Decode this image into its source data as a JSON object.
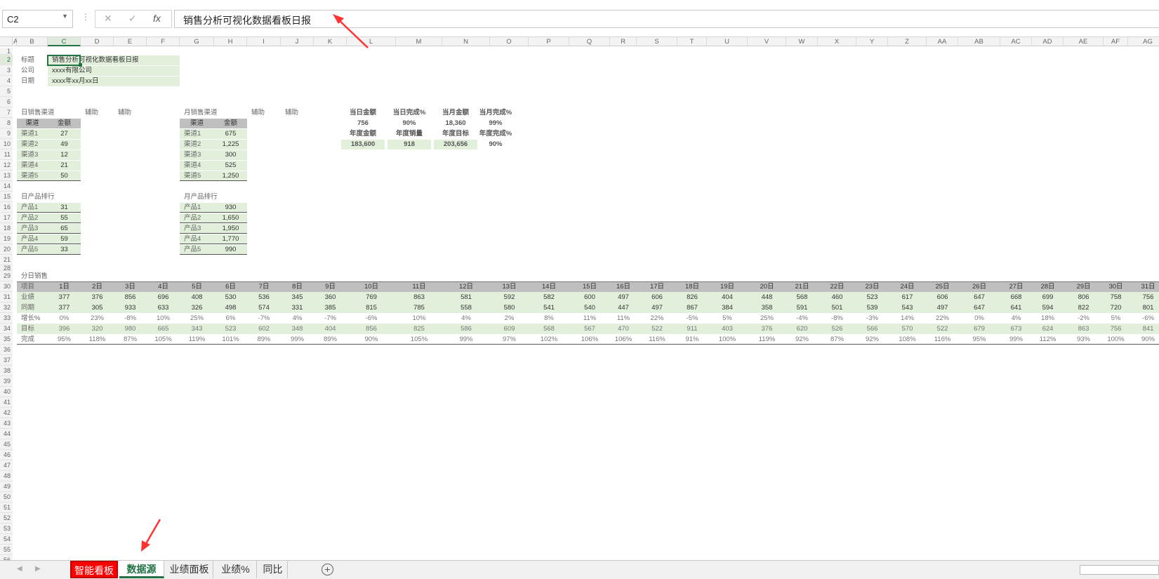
{
  "app": {
    "name_box": "C2",
    "formula": "销售分析可视化数据看板日报"
  },
  "columns": [
    "A",
    "B",
    "C",
    "D",
    "E",
    "F",
    "G",
    "H",
    "I",
    "J",
    "K",
    "L",
    "M",
    "N",
    "O",
    "P",
    "Q",
    "R",
    "S",
    "T",
    "U",
    "V",
    "W",
    "X",
    "Y",
    "Z",
    "AA",
    "AB",
    "AC",
    "AD",
    "AE",
    "AF",
    "AG"
  ],
  "selected_col": "C",
  "selected_row": "2",
  "rows": [
    "1",
    "2",
    "3",
    "4",
    "5",
    "6",
    "7",
    "8",
    "9",
    "10",
    "11",
    "12",
    "13",
    "14",
    "15",
    "16",
    "17",
    "18",
    "19",
    "20",
    "21",
    "28",
    "29",
    "30",
    "31",
    "32",
    "33",
    "34",
    "35",
    "36",
    "37",
    "38",
    "39",
    "40",
    "41",
    "42",
    "43",
    "44",
    "45",
    "46",
    "47",
    "48",
    "49",
    "50",
    "51",
    "52",
    "53",
    "54",
    "55",
    "56"
  ],
  "header_block": {
    "labels": [
      "标题",
      "公司",
      "日期"
    ],
    "values": [
      "销售分析可视化数据看板日报",
      "xxxx有限公司",
      "xxxx年xx月xx日"
    ]
  },
  "daily_channel": {
    "title": "日销售渠道",
    "aux": [
      "辅助",
      "辅助"
    ],
    "head": [
      "渠道",
      "金额"
    ],
    "rows": [
      [
        "渠道1",
        "27"
      ],
      [
        "渠道2",
        "49"
      ],
      [
        "渠道3",
        "12"
      ],
      [
        "渠道4",
        "21"
      ],
      [
        "渠道5",
        "50"
      ]
    ]
  },
  "monthly_channel": {
    "title": "月销售渠道",
    "aux": [
      "辅助",
      "辅助"
    ],
    "head": [
      "渠道",
      "金额"
    ],
    "rows": [
      [
        "渠道1",
        "675"
      ],
      [
        "渠道2",
        "1,225"
      ],
      [
        "渠道3",
        "300"
      ],
      [
        "渠道4",
        "525"
      ],
      [
        "渠道5",
        "1,250"
      ]
    ]
  },
  "kpi": {
    "r1_labels": [
      "当日金额",
      "当日完成%",
      "当月金额",
      "当月完成%"
    ],
    "r1_values": [
      "756",
      "90%",
      "18,360",
      "99%"
    ],
    "r2_labels": [
      "年度金额",
      "年度销量",
      "年度目标",
      "年度完成%"
    ],
    "r2_values": [
      "183,600",
      "918",
      "203,656",
      "90%"
    ]
  },
  "daily_product": {
    "title": "日产品排行",
    "rows": [
      [
        "产品1",
        "31"
      ],
      [
        "产品2",
        "55"
      ],
      [
        "产品3",
        "65"
      ],
      [
        "产品4",
        "59"
      ],
      [
        "产品5",
        "33"
      ]
    ]
  },
  "monthly_product": {
    "title": "月产品排行",
    "rows": [
      [
        "产品1",
        "930"
      ],
      [
        "产品2",
        "1,650"
      ],
      [
        "产品3",
        "1,950"
      ],
      [
        "产品4",
        "1,770"
      ],
      [
        "产品5",
        "990"
      ]
    ]
  },
  "daily_sales": {
    "title": "分日销售",
    "header_label": "项目",
    "days": [
      "1日",
      "2日",
      "3日",
      "4日",
      "5日",
      "6日",
      "7日",
      "8日",
      "9日",
      "10日",
      "11日",
      "12日",
      "13日",
      "14日",
      "15日",
      "16日",
      "17日",
      "18日",
      "19日",
      "20日",
      "21日",
      "22日",
      "23日",
      "24日",
      "25日",
      "26日",
      "27日",
      "28日",
      "29日",
      "30日",
      "31日"
    ],
    "rows": [
      {
        "label": "业绩",
        "values": [
          "377",
          "376",
          "856",
          "696",
          "408",
          "530",
          "536",
          "345",
          "360",
          "769",
          "863",
          "581",
          "592",
          "582",
          "600",
          "497",
          "606",
          "826",
          "404",
          "448",
          "568",
          "460",
          "523",
          "617",
          "606",
          "647",
          "668",
          "699",
          "806",
          "758",
          "756"
        ]
      },
      {
        "label": "同期",
        "values": [
          "377",
          "305",
          "933",
          "633",
          "326",
          "498",
          "574",
          "331",
          "385",
          "815",
          "785",
          "558",
          "580",
          "541",
          "540",
          "447",
          "497",
          "867",
          "384",
          "358",
          "591",
          "501",
          "539",
          "543",
          "497",
          "647",
          "641",
          "594",
          "822",
          "720",
          "801"
        ]
      },
      {
        "label": "增长%",
        "values": [
          "0%",
          "23%",
          "-8%",
          "10%",
          "25%",
          "6%",
          "-7%",
          "4%",
          "-7%",
          "-6%",
          "10%",
          "4%",
          "2%",
          "8%",
          "11%",
          "11%",
          "22%",
          "-5%",
          "5%",
          "25%",
          "-4%",
          "-8%",
          "-3%",
          "14%",
          "22%",
          "0%",
          "4%",
          "18%",
          "-2%",
          "5%",
          "-6%"
        ]
      },
      {
        "label": "目标",
        "values": [
          "396",
          "320",
          "980",
          "665",
          "343",
          "523",
          "602",
          "348",
          "404",
          "856",
          "825",
          "586",
          "609",
          "568",
          "567",
          "470",
          "522",
          "911",
          "403",
          "376",
          "620",
          "526",
          "566",
          "570",
          "522",
          "679",
          "673",
          "624",
          "863",
          "756",
          "841"
        ]
      },
      {
        "label": "完成",
        "values": [
          "95%",
          "118%",
          "87%",
          "105%",
          "119%",
          "101%",
          "89%",
          "99%",
          "89%",
          "90%",
          "105%",
          "99%",
          "97%",
          "102%",
          "106%",
          "106%",
          "116%",
          "91%",
          "100%",
          "119%",
          "92%",
          "87%",
          "92%",
          "108%",
          "116%",
          "95%",
          "99%",
          "112%",
          "93%",
          "100%",
          "90%"
        ]
      }
    ]
  },
  "sheets": [
    "智能看板",
    "数据源",
    "业绩面板",
    "业绩%",
    "同比"
  ],
  "active_sheet": "数据源",
  "colors": {
    "accent": "#217346",
    "red_tab": "#ff0000",
    "green_fill": "#e2efda",
    "gray_fill": "#bfbfbf",
    "negative": "#e00000",
    "annotation": "#ff3333"
  }
}
